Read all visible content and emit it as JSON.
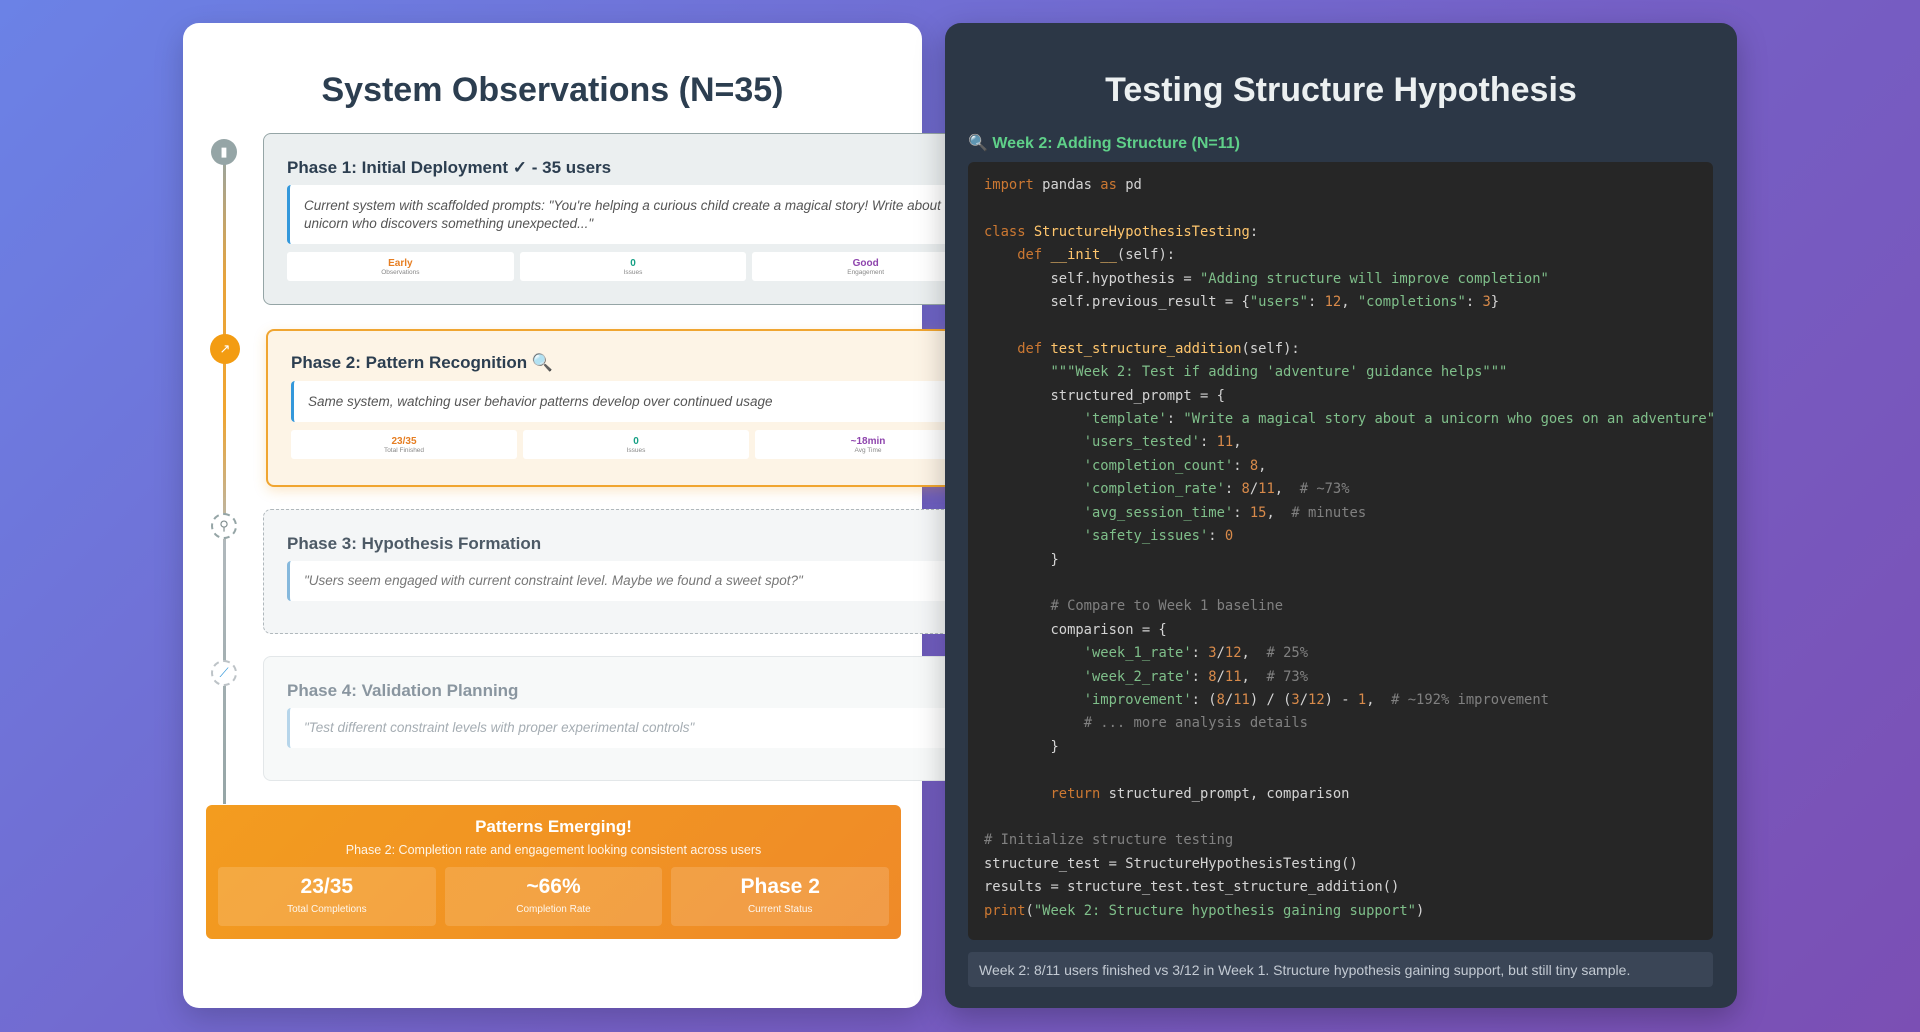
{
  "left": {
    "title": "System Observations (N=35)",
    "phases": [
      {
        "title": "Phase 1: Initial Deployment ✓ - 35 users",
        "quote": "Current system with scaffolded prompts: \"You're helping a curious child create a magical story! Write about a unicorn who discovers something unexpected...\"",
        "metrics": [
          {
            "value": "Early",
            "label": "Observations",
            "color": "#e67e22"
          },
          {
            "value": "0",
            "label": "Issues",
            "color": "#16a085"
          },
          {
            "value": "Good",
            "label": "Engagement",
            "color": "#8e44ad"
          }
        ],
        "icon": "chart-icon"
      },
      {
        "title": "Phase 2: Pattern Recognition 🔍",
        "quote": "Same system, watching user behavior patterns develop over continued usage",
        "metrics": [
          {
            "value": "23/35",
            "label": "Total Finished",
            "color": "#e67e22"
          },
          {
            "value": "0",
            "label": "Issues",
            "color": "#16a085"
          },
          {
            "value": "~18min",
            "label": "Avg Time",
            "color": "#8e44ad"
          }
        ],
        "icon": "trend-icon"
      },
      {
        "title": "Phase 3: Hypothesis Formation",
        "quote": "\"Users seem engaged with current constraint level. Maybe we found a sweet spot?\"",
        "icon": "microscope-icon"
      },
      {
        "title": "Phase 4: Validation Planning",
        "quote": "\"Test different constraint levels with proper experimental controls\"",
        "icon": "test-tube-icon"
      }
    ],
    "summary": {
      "title": "Patterns Emerging!",
      "subtitle": "Phase 2: Completion rate and engagement looking consistent across users",
      "stats": [
        {
          "value": "23/35",
          "label": "Total Completions"
        },
        {
          "value": "~66%",
          "label": "Completion Rate"
        },
        {
          "value": "Phase 2",
          "label": "Current Status"
        }
      ]
    }
  },
  "right": {
    "title": "Testing Structure Hypothesis",
    "week_label": "🔍 Week 2: Adding Structure (N=11)",
    "footer": "Week 2: 8/11 users finished vs 3/12 in Week 1. Structure hypothesis gaining support, but still tiny sample."
  }
}
